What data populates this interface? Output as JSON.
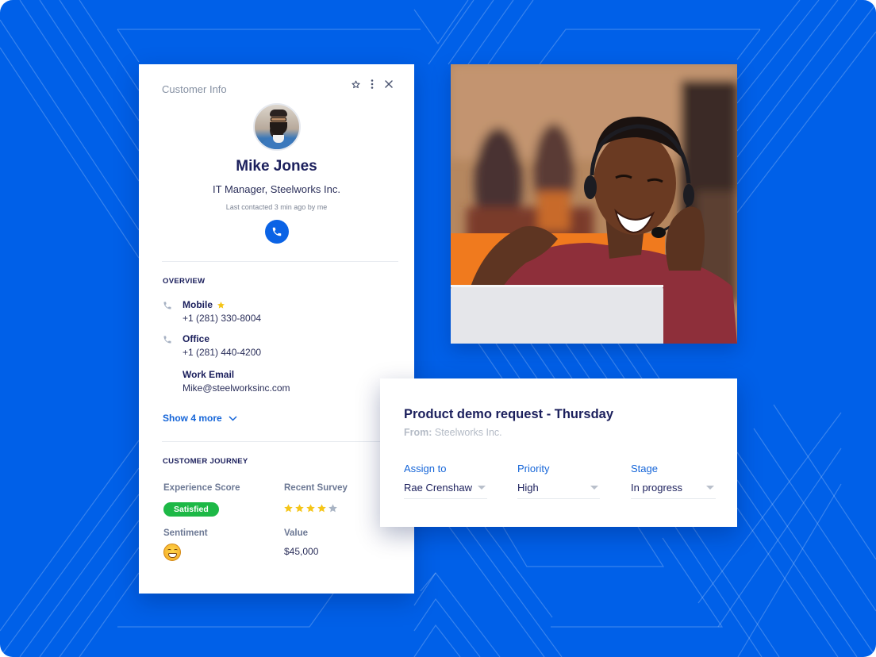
{
  "customer_card": {
    "title": "Customer Info",
    "header_icons": [
      "star-outline-icon",
      "more-vertical-icon",
      "close-icon"
    ],
    "name": "Mike Jones",
    "job_title": "IT Manager, Steelworks Inc.",
    "last_contacted": "Last contacted 3 min ago by me",
    "overview": {
      "heading": "OVERVIEW",
      "contacts": [
        {
          "label": "Mobile",
          "value": "+1 (281) 330-8004",
          "icon": "phone-icon",
          "favorite": true
        },
        {
          "label": "Office",
          "value": "+1 (281) 440-4200",
          "icon": "phone-icon",
          "favorite": false
        },
        {
          "label": "Work Email",
          "value": "Mike@steelworksinc.com",
          "icon": "",
          "favorite": false
        }
      ],
      "show_more": "Show 4 more"
    },
    "journey": {
      "heading": "CUSTOMER JOURNEY",
      "experience_score_label": "Experience Score",
      "experience_score_value": "Satisfied",
      "recent_survey_label": "Recent Survey",
      "recent_survey_rating": 4,
      "recent_survey_max": 5,
      "sentiment_label": "Sentiment",
      "sentiment_emoji": "grinning-face",
      "value_label": "Value",
      "value": "$45,000"
    }
  },
  "photo": {
    "description": "Smiling support agent wearing a headset at a laptop"
  },
  "request_card": {
    "title": "Product demo request - Thursday",
    "from_label": "From:",
    "from_value": "Steelworks Inc.",
    "fields": [
      {
        "label": "Assign to",
        "value": "Rae Crenshaw"
      },
      {
        "label": "Priority",
        "value": "High"
      },
      {
        "label": "Stage",
        "value": "In progress"
      }
    ]
  },
  "colors": {
    "background": "#0060E8",
    "accent": "#1565D8",
    "heading": "#1B1F5C",
    "badge_green": "#1DB846",
    "star_gold": "#F5C518",
    "star_empty": "#A9B4C4"
  }
}
